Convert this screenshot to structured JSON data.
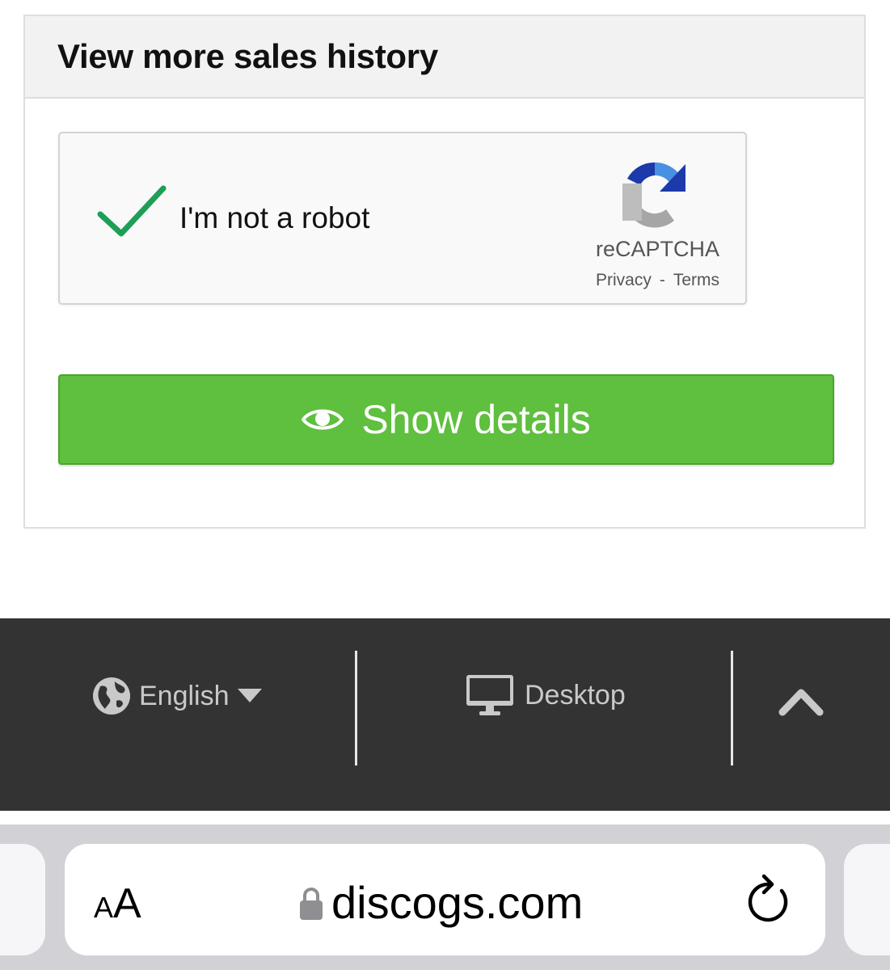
{
  "card": {
    "title": "View more sales history"
  },
  "recaptcha": {
    "label": "I'm not a robot",
    "brand": "reCAPTCHA",
    "privacy": "Privacy",
    "separator": "-",
    "terms": "Terms",
    "checked": true,
    "check_color": "#1e9e57"
  },
  "button": {
    "label": "Show details",
    "icon": "eye-icon",
    "color": "#5fbf3e"
  },
  "footer": {
    "language": "English",
    "language_icon": "globe-icon",
    "view_mode": "Desktop",
    "view_icon": "monitor-icon",
    "back_to_top_icon": "chevron-up-icon",
    "background": "#333333"
  },
  "browser": {
    "text_size_small": "A",
    "text_size_big": "A",
    "domain": "discogs.com",
    "lock_icon": "lock-icon",
    "reload_icon": "reload-icon"
  }
}
